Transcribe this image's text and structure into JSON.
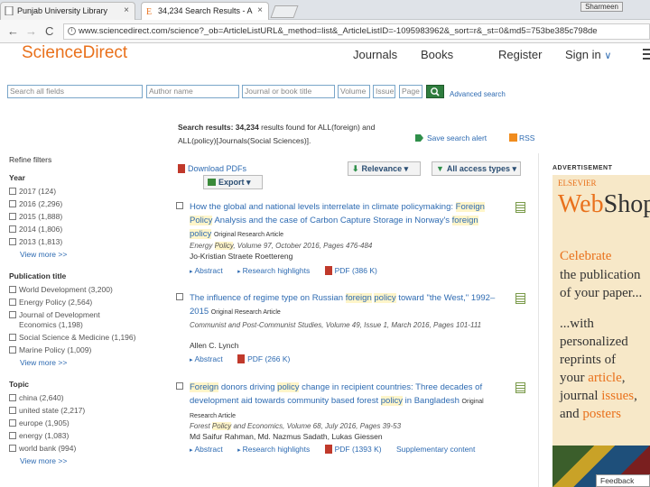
{
  "browser": {
    "tabs": [
      {
        "label": "Punjab University Library",
        "close": "×"
      },
      {
        "label": "34,234 Search Results - A",
        "close": "×"
      }
    ],
    "window_user": "Sharmeen",
    "back": "←",
    "forward": "→",
    "reload": "C",
    "url": "www.sciencedirect.com/science?_ob=ArticleListURL&_method=list&_ArticleListID=-1095983962&_sort=r&_st=0&md5=753be385c798de"
  },
  "header": {
    "logo": "ScienceDirect",
    "nav": [
      "Journals",
      "Books",
      "Register",
      "Sign in"
    ],
    "signin_chevron": "∨"
  },
  "search": {
    "all_fields": "Search all fields",
    "author": "Author name",
    "journal": "Journal or book title",
    "volume": "Volume",
    "issue": "Issue",
    "page": "Page",
    "advanced": "Advanced search"
  },
  "results_header": {
    "prefix": "Search results:",
    "count": "34,234",
    "rest": "results found for ALL(foreign) and ALL(policy)[Journals(Social Sciences)].",
    "save_alert": "Save search alert",
    "rss": "RSS"
  },
  "sidebar": {
    "refine": "Refine filters",
    "groups": [
      {
        "title": "Year",
        "items": [
          "2017 (124)",
          "2016 (2,296)",
          "2015 (1,888)",
          "2014 (1,806)",
          "2013 (1,813)"
        ],
        "more": "View more >>"
      },
      {
        "title": "Publication title",
        "items": [
          "World Development (3,200)",
          "Energy Policy (2,564)",
          "Journal of Development Economics (1,198)",
          "Social Science & Medicine (1,196)",
          "Marine Policy (1,009)"
        ],
        "more": "View more >>"
      },
      {
        "title": "Topic",
        "items": [
          "china (2,640)",
          "united state (2,217)",
          "europe (1,905)",
          "energy (1,083)",
          "world bank (994)"
        ],
        "more": "View more >>"
      }
    ]
  },
  "toolbar": {
    "download": "Download PDFs",
    "export": "Export",
    "relevance": "Relevance",
    "access": "All access types",
    "caret": "▾"
  },
  "results": [
    {
      "title_parts": [
        {
          "t": "How the global and national levels interrelate in climate policymaking: ",
          "h": false
        },
        {
          "t": "Foreign",
          "h": true
        },
        {
          "t": " ",
          "h": false
        },
        {
          "t": "Policy",
          "h": true
        },
        {
          "t": " Analysis and the case of Carbon Capture Storage in Norway's ",
          "h": false
        },
        {
          "t": "foreign",
          "h": true
        },
        {
          "t": " ",
          "h": false
        },
        {
          "t": "policy",
          "h": true
        },
        {
          "t": " ",
          "h": false
        }
      ],
      "type": "Original Research Article",
      "meta_parts": [
        {
          "t": "Energy ",
          "h": false
        },
        {
          "t": "Policy",
          "h": true
        },
        {
          "t": ", Volume 97, October 2016, Pages 476-484",
          "h": false
        }
      ],
      "authors": "Jo-Kristian Straete Roettereng",
      "links": [
        "Abstract",
        "Research highlights",
        "PDF (386 K)"
      ]
    },
    {
      "title_parts": [
        {
          "t": "The influence of regime type on Russian ",
          "h": false
        },
        {
          "t": "foreign",
          "h": true
        },
        {
          "t": " ",
          "h": false
        },
        {
          "t": "policy",
          "h": true
        },
        {
          "t": " toward \"the West,\" 1992–2015 ",
          "h": false
        }
      ],
      "type": "Original Research Article",
      "meta_parts": [
        {
          "t": "Communist and Post-Communist Studies, Volume 49, Issue 1, March 2016, Pages 101-111",
          "h": false
        }
      ],
      "authors": "Allen C. Lynch",
      "links": [
        "Abstract",
        "PDF (266 K)"
      ]
    },
    {
      "title_parts": [
        {
          "t": "Foreign",
          "h": true
        },
        {
          "t": " donors driving ",
          "h": false
        },
        {
          "t": "policy",
          "h": true
        },
        {
          "t": " change in recipient countries: Three decades of development aid towards community based forest ",
          "h": false
        },
        {
          "t": "policy",
          "h": true
        },
        {
          "t": " in Bangladesh ",
          "h": false
        }
      ],
      "type": "Original Research Article",
      "meta_parts": [
        {
          "t": "Forest ",
          "h": false
        },
        {
          "t": "Policy",
          "h": true
        },
        {
          "t": " and Economics, Volume 68, July 2016, Pages 39-53",
          "h": false
        }
      ],
      "authors": "Md Saifur Rahman, Md. Nazmus Sadath, Lukas Giessen",
      "links": [
        "Abstract",
        "Research highlights",
        "PDF (1393 K)",
        "Supplementary content"
      ]
    }
  ],
  "ad": {
    "label": "ADVERTISEMENT",
    "elsevier": "ELSEVIER",
    "webshop_a": "Web",
    "webshop_b": "Shop",
    "celebrate": "Celebrate",
    "lines": [
      "the publication",
      "of your paper...",
      "...with",
      "personalized",
      "reprints of"
    ],
    "your_article_a": "your ",
    "your_article_b": "article",
    "journal_a": "journal ",
    "journal_b": "issues",
    "posters_a": "and ",
    "posters_b": "posters",
    "comma": ","
  },
  "feedback": "Feedback"
}
